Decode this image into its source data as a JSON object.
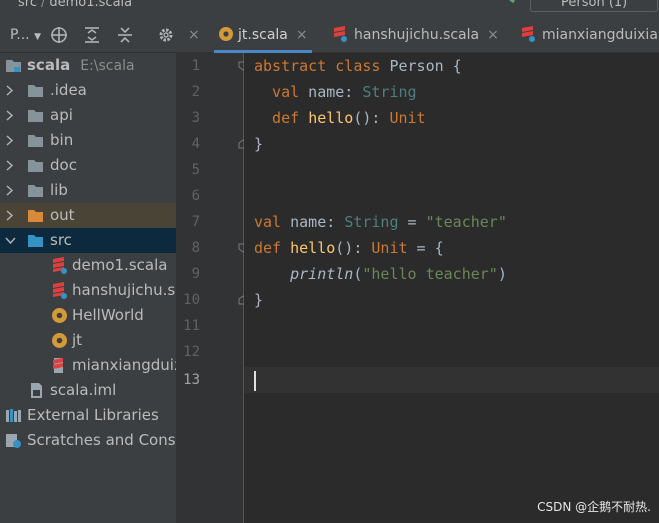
{
  "breadcrumb": {
    "root": "src",
    "separator": "/",
    "file": "demo1.scala"
  },
  "run_config": {
    "label": "Person (1)"
  },
  "project_view": {
    "label": "P..."
  },
  "tabs": [
    {
      "label": "jt.scala",
      "icon": "scala-object-icon",
      "active": true,
      "close": "×"
    },
    {
      "label": "hanshujichu.scala",
      "icon": "scala-file-icon",
      "active": false,
      "close": "×"
    },
    {
      "label": "mianxiangduixia",
      "icon": "scala-file-icon",
      "active": false
    }
  ],
  "tree": [
    {
      "label": "scala",
      "path": "E:\\scala",
      "icon": "project-folder-icon"
    },
    {
      "label": ".idea",
      "icon": "folder-icon"
    },
    {
      "label": "api",
      "icon": "folder-icon"
    },
    {
      "label": "bin",
      "icon": "folder-icon"
    },
    {
      "label": "doc",
      "icon": "folder-icon"
    },
    {
      "label": "lib",
      "icon": "folder-icon"
    },
    {
      "label": "out",
      "icon": "excluded-folder-icon"
    },
    {
      "label": "src",
      "icon": "source-folder-icon"
    },
    {
      "label": "demo1.scala",
      "icon": "scala-file-icon"
    },
    {
      "label": "hanshujichu.sc",
      "icon": "scala-file-icon"
    },
    {
      "label": "HellWorld",
      "icon": "scala-object-icon"
    },
    {
      "label": "jt",
      "icon": "scala-object-icon"
    },
    {
      "label": "mianxiangduix",
      "icon": "scala-file-icon"
    },
    {
      "label": "scala.iml",
      "icon": "iml-file-icon"
    },
    {
      "label": "External Libraries",
      "icon": "library-icon"
    },
    {
      "label": "Scratches and Consc",
      "icon": "scratches-icon"
    }
  ],
  "line_numbers": [
    "1",
    "2",
    "3",
    "4",
    "5",
    "6",
    "7",
    "8",
    "9",
    "10",
    "11",
    "12",
    "13"
  ],
  "code": {
    "l1": [
      "abstract class",
      " Person {"
    ],
    "l2": [
      "  val",
      " name: ",
      "String"
    ],
    "l3": [
      "  def",
      " ",
      "hello",
      "(): ",
      "Unit"
    ],
    "l4": [
      "}"
    ],
    "l7": [
      "val",
      " name: ",
      "String",
      " = ",
      "\"teacher\""
    ],
    "l8": [
      "def",
      " ",
      "hello",
      "(): ",
      "Unit",
      " = {"
    ],
    "l9": [
      "    ",
      "println",
      "(",
      "\"hello teacher\"",
      ")"
    ],
    "l10": [
      "}"
    ]
  },
  "current_line": "13",
  "watermark": "CSDN @企鹅不耐热."
}
